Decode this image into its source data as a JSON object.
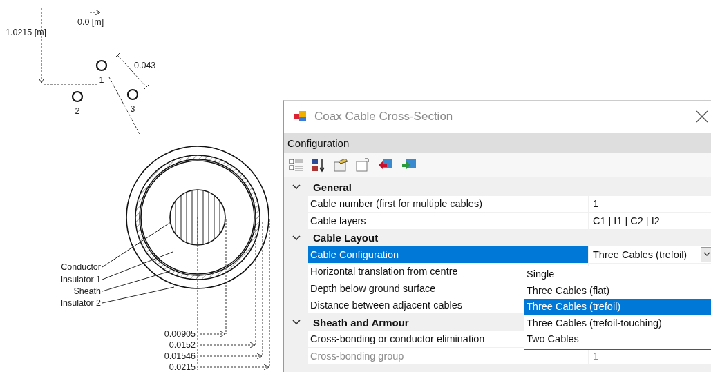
{
  "diagram": {
    "depth_label": "1.0215 [m]",
    "horizontal_label": "0.0 [m]",
    "spacing_label": "0.043",
    "cables": [
      {
        "label": "1"
      },
      {
        "label": "2"
      },
      {
        "label": "3"
      }
    ],
    "layers": [
      "Conductor",
      "Insulator 1",
      "Sheath",
      "Insulator 2"
    ],
    "radii": [
      "0.00905",
      "0.0152",
      "0.01546",
      "0.0215"
    ]
  },
  "window": {
    "title": "Coax Cable Cross-Section"
  },
  "panel": {
    "title": "Configuration"
  },
  "categories": [
    {
      "name": "General",
      "expanded": true,
      "properties": [
        {
          "name": "Cable number (first for multiple cables)",
          "value": "1",
          "kind": "text",
          "selected": false,
          "disabled": false
        },
        {
          "name": "Cable layers",
          "value": "C1 | I1 | C2 | I2",
          "kind": "text",
          "selected": false,
          "disabled": false
        }
      ]
    },
    {
      "name": "Cable Layout",
      "expanded": true,
      "properties": [
        {
          "name": "Cable Configuration",
          "value": "Three Cables (trefoil)",
          "kind": "dropdown",
          "selected": true,
          "disabled": false
        },
        {
          "name": "Horizontal translation from centre",
          "kind": "text",
          "selected": false,
          "disabled": false
        },
        {
          "name": "Depth below ground surface",
          "kind": "text",
          "selected": false,
          "disabled": false
        },
        {
          "name": "Distance between adjacent cables",
          "kind": "text",
          "selected": false,
          "disabled": false
        }
      ]
    },
    {
      "name": "Sheath and Armour",
      "expanded": true,
      "properties": [
        {
          "name": "Cross-bonding or conductor elimination",
          "kind": "text",
          "selected": false,
          "disabled": false
        },
        {
          "name": "Cross-bonding group",
          "value": "1",
          "kind": "text",
          "selected": false,
          "disabled": true
        }
      ]
    }
  ],
  "dropdown": {
    "options": [
      {
        "label": "Single",
        "selected": false
      },
      {
        "label": "Three Cables (flat)",
        "selected": false
      },
      {
        "label": "Three Cables (trefoil)",
        "selected": true
      },
      {
        "label": "Three Cables (trefoil-touching)",
        "selected": false
      },
      {
        "label": "Two Cables",
        "selected": false
      }
    ]
  }
}
